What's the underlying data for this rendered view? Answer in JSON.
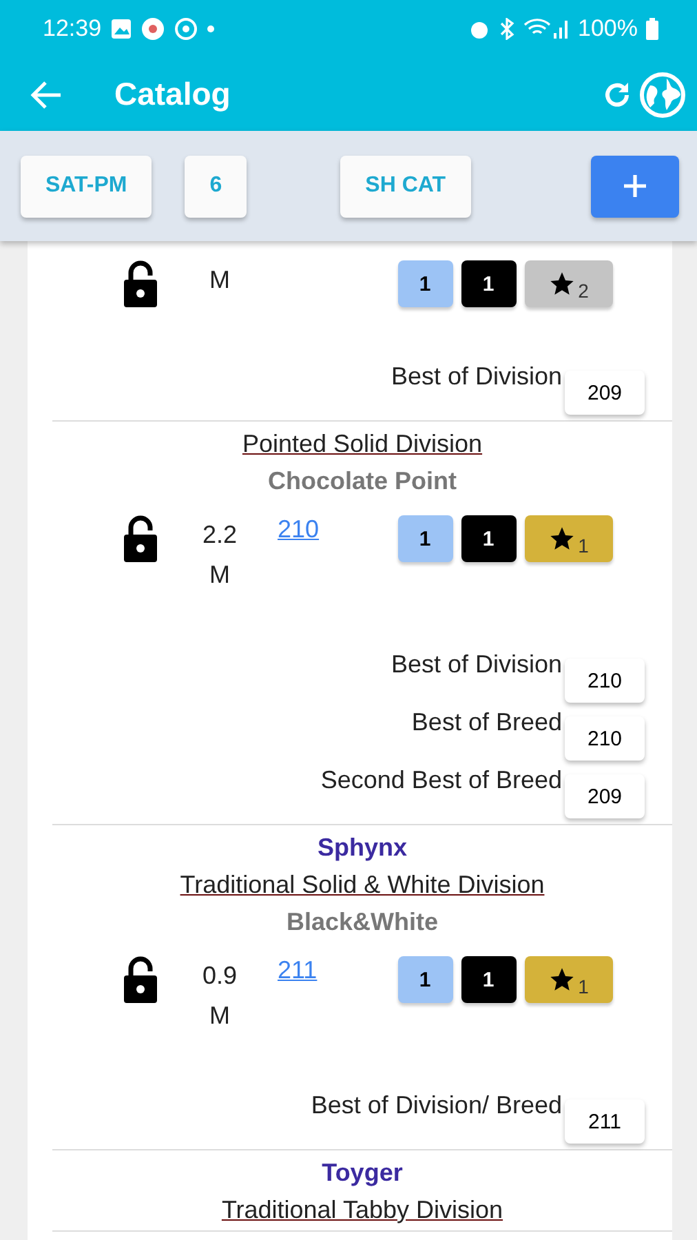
{
  "status_bar": {
    "time": "12:39",
    "battery": "100%"
  },
  "app_bar": {
    "title": "Catalog"
  },
  "toolbar": {
    "buttons": [
      "SAT-PM",
      "6",
      "SH CAT"
    ]
  },
  "entries": [
    {
      "locked": false,
      "age": "M",
      "badges": [
        "1",
        "1"
      ],
      "star": {
        "count": "2",
        "color": "#c4c4c4"
      },
      "awards": [
        {
          "label": "Best of Division",
          "number": "209"
        }
      ]
    },
    {
      "division": "Pointed Solid Division",
      "color_name": "Chocolate Point",
      "locked": false,
      "age": "2.2 M",
      "link": "210",
      "badges": [
        "1",
        "1"
      ],
      "star": {
        "count": "1",
        "color": "#d4b23a"
      },
      "awards": [
        {
          "label": "Best of Division",
          "number": "210"
        },
        {
          "label": "Best of Breed",
          "number": "210"
        },
        {
          "label": "Second Best of Breed",
          "number": "209"
        }
      ]
    },
    {
      "breed": "Sphynx",
      "division": "Traditional Solid & White Division",
      "color_name": "Black&White",
      "locked": false,
      "age": "0.9 M",
      "link": "211",
      "badges": [
        "1",
        "1"
      ],
      "star": {
        "count": "1",
        "color": "#d4b23a"
      },
      "awards": [
        {
          "label": "Best of Division/ Breed",
          "number": "211"
        }
      ]
    },
    {
      "breed": "Toyger",
      "division": "Traditional Tabby Division"
    }
  ]
}
